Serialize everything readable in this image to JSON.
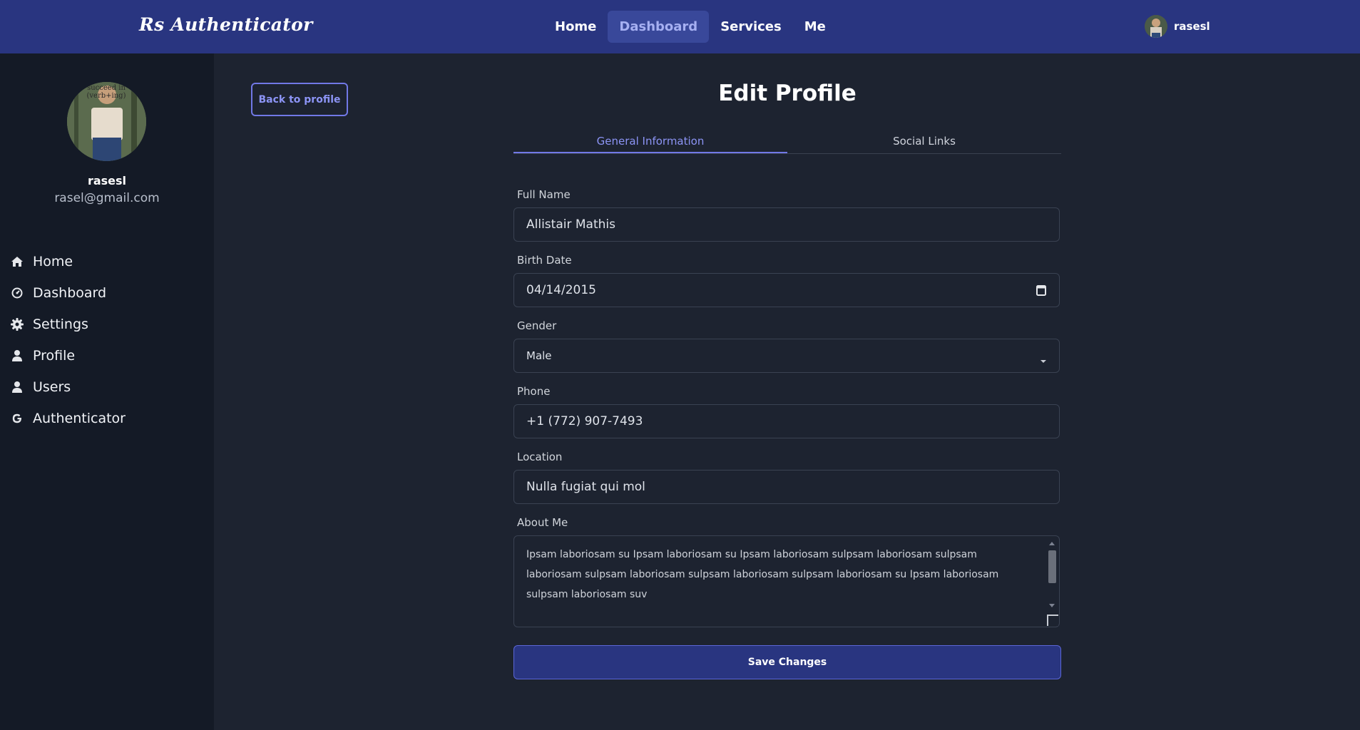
{
  "header": {
    "brand": "Rs Authenticator",
    "nav": [
      {
        "label": "Home",
        "active": false
      },
      {
        "label": "Dashboard",
        "active": true
      },
      {
        "label": "Services",
        "active": false
      },
      {
        "label": "Me",
        "active": false
      }
    ],
    "user": {
      "name": "rasesl"
    }
  },
  "sidebar": {
    "profile": {
      "name": "rasesl",
      "email": "rasel@gmail.com",
      "avatar_caption": "succeed in (verb+ing)"
    },
    "items": [
      {
        "label": "Home",
        "icon": "home-icon"
      },
      {
        "label": "Dashboard",
        "icon": "dashboard-gauge-icon"
      },
      {
        "label": "Settings",
        "icon": "gear-icon"
      },
      {
        "label": "Profile",
        "icon": "user-icon"
      },
      {
        "label": "Users",
        "icon": "users-icon"
      },
      {
        "label": "Authenticator",
        "icon": "google-g-icon"
      }
    ]
  },
  "main": {
    "back_button": "Back to profile",
    "title": "Edit Profile",
    "tabs": [
      {
        "label": "General Information",
        "active": true
      },
      {
        "label": "Social Links",
        "active": false
      }
    ],
    "form": {
      "full_name": {
        "label": "Full Name",
        "value": "Allistair Mathis"
      },
      "birth_date": {
        "label": "Birth Date",
        "value": "04/14/2015"
      },
      "gender": {
        "label": "Gender",
        "value": "Male"
      },
      "phone": {
        "label": "Phone",
        "value": "+1 (772) 907-7493"
      },
      "location": {
        "label": "Location",
        "value": "Nulla fugiat qui mol"
      },
      "about": {
        "label": "About Me",
        "value": "Ipsam laboriosam su Ipsam laboriosam su Ipsam laboriosam sulpsam laboriosam sulpsam laboriosam sulpsam laboriosam sulpsam laboriosam sulpsam laboriosam su Ipsam laboriosam sulpsam laboriosam suv"
      }
    },
    "save_button": "Save Changes"
  },
  "colors": {
    "navbar": "#293580",
    "page_bg": "#1d2330",
    "sidebar_bg": "#141a26",
    "accent": "#7178e6",
    "accent_text": "#8c94f5"
  }
}
